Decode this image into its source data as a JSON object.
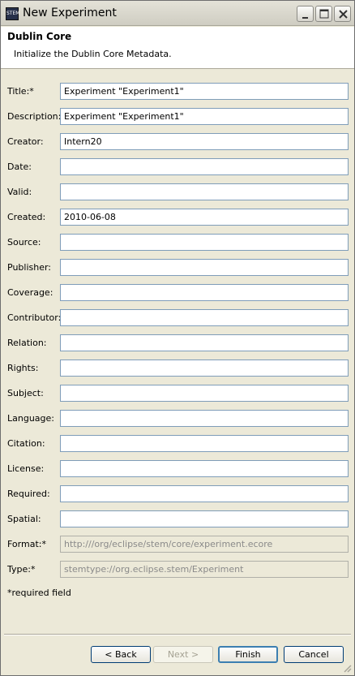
{
  "window": {
    "title": "New Experiment",
    "icon_label": "STEM"
  },
  "header": {
    "title": "Dublin Core",
    "subtitle": "Initialize the Dublin Core Metadata."
  },
  "fields": [
    {
      "label": "Title:*",
      "value": "Experiment \"Experiment1\"",
      "readonly": false
    },
    {
      "label": "Description:",
      "value": "Experiment \"Experiment1\"",
      "readonly": false
    },
    {
      "label": "Creator:",
      "value": "Intern20",
      "readonly": false
    },
    {
      "label": "Date:",
      "value": "",
      "readonly": false
    },
    {
      "label": "Valid:",
      "value": "",
      "readonly": false
    },
    {
      "label": "Created:",
      "value": "2010-06-08",
      "readonly": false
    },
    {
      "label": "Source:",
      "value": "",
      "readonly": false
    },
    {
      "label": "Publisher:",
      "value": "",
      "readonly": false
    },
    {
      "label": "Coverage:",
      "value": "",
      "readonly": false
    },
    {
      "label": "Contributor:",
      "value": "",
      "readonly": false
    },
    {
      "label": "Relation:",
      "value": "",
      "readonly": false
    },
    {
      "label": "Rights:",
      "value": "",
      "readonly": false
    },
    {
      "label": "Subject:",
      "value": "",
      "readonly": false
    },
    {
      "label": "Language:",
      "value": "",
      "readonly": false
    },
    {
      "label": "Citation:",
      "value": "",
      "readonly": false
    },
    {
      "label": "License:",
      "value": "",
      "readonly": false
    },
    {
      "label": "Required:",
      "value": "",
      "readonly": false
    },
    {
      "label": "Spatial:",
      "value": "",
      "readonly": false
    },
    {
      "label": "Format:*",
      "value": "http:///org/eclipse/stem/core/experiment.ecore",
      "readonly": true
    },
    {
      "label": "Type:*",
      "value": "stemtype://org.eclipse.stem/Experiment",
      "readonly": true
    }
  ],
  "required_note": "*required field",
  "buttons": {
    "back": "< Back",
    "next": "Next >",
    "finish": "Finish",
    "cancel": "Cancel"
  },
  "colors": {
    "dialog_bg": "#ece9d8",
    "field_border": "#7f9db9",
    "default_button_border": "#3c7fb1"
  }
}
